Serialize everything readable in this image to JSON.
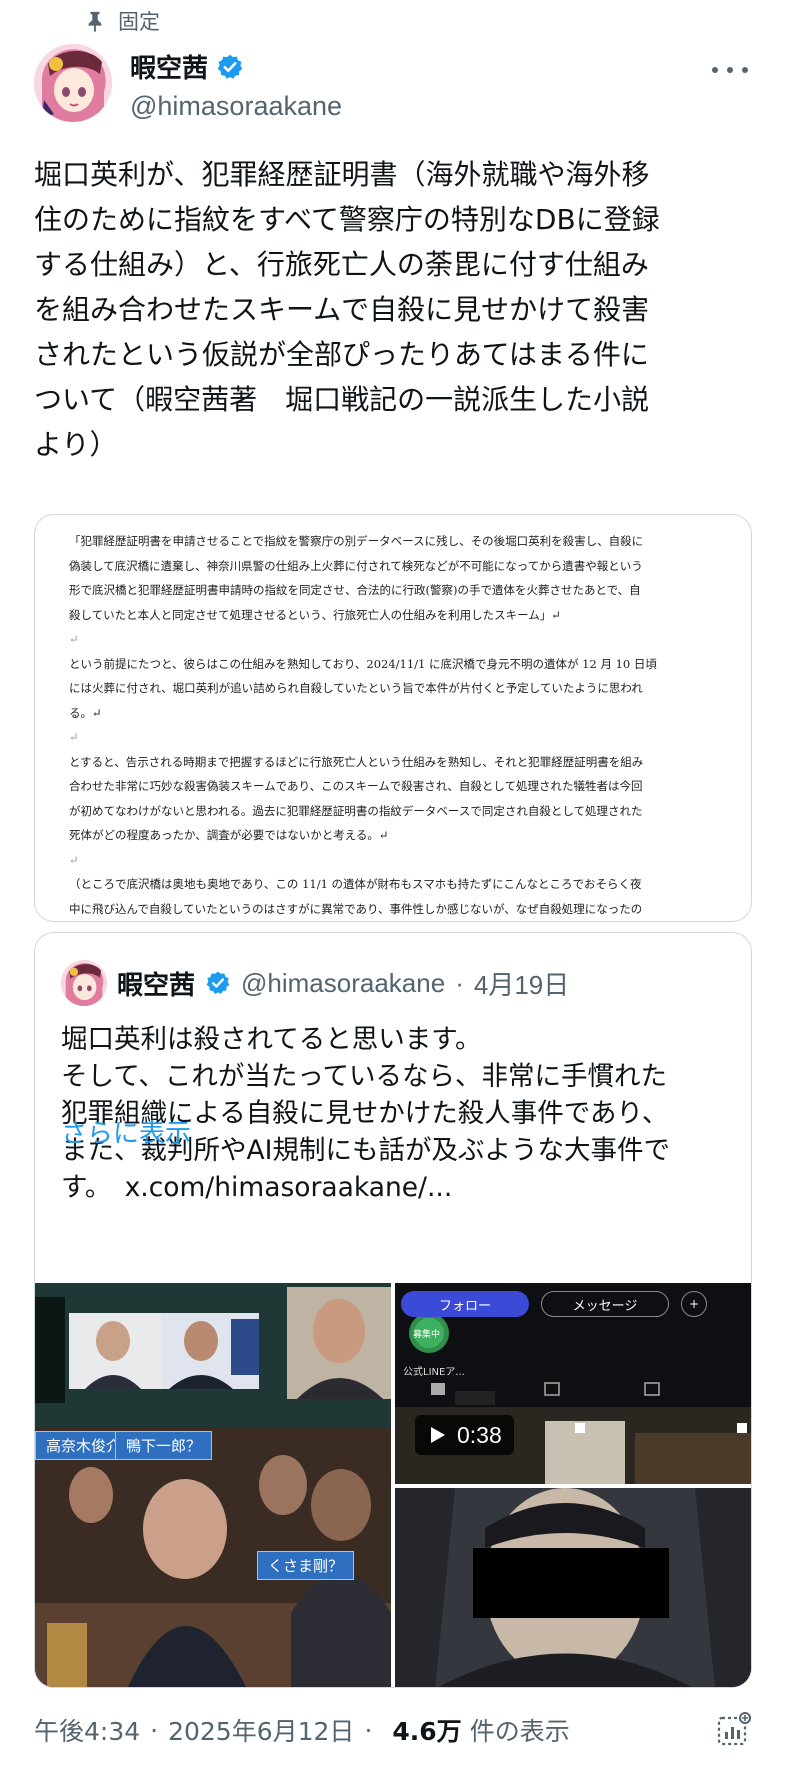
{
  "pinned": {
    "label": "固定"
  },
  "author": {
    "display_name": "暇空茜",
    "handle": "@himasoraakane"
  },
  "tweet": {
    "text": "堀口英利が、犯罪経歴証明書（海外就職や海外移\n住のために指紋をすべて警察庁の特別なDBに登録\nする仕組み）と、行旅死亡人の荼毘に付す仕組み\nを組み合わせたスキームで自殺に見せかけて殺害\nされたという仮説が全部ぴったりあてはまる件に\nついて（暇空茜著　堀口戦記の一説派生した小説\nより）"
  },
  "document": {
    "paragraphs": [
      "「犯罪経歴証明書を申請させることで指紋を警察庁の別データベースに残し、その後堀口英利を殺害し、自殺に\n偽装して底沢橋に遺棄し、神奈川県警の仕組み上火葬に付されて検死などが不可能になってから遺書や報という\n形で底沢橋と犯罪経歴証明書申請時の指紋を同定させ、合法的に行政(警察)の手で遺体を火葬させたあとで、自\n殺していたと本人と同定させて処理させるという、行旅死亡人の仕組みを利用したスキーム」↵",
      "↵",
      "という前提にたつと、彼らはこの仕組みを熟知しており、2024/11/1 に底沢橋で身元不明の遺体が 12 月 10 日頃\nには火葬に付され、堀口英利が追い詰められ自殺していたという旨で本件が片付くと予定していたように思われ\nる。↵",
      "↵",
      "とすると、告示される時期まで把握するほどに行旅死亡人という仕組みを熟知し、それと犯罪経歴証明書を組み\n合わせた非常に巧妙な殺害偽装スキームであり、このスキームで殺害され、自殺として処理された犠牲者は今回\nが初めてなわけがないと思われる。過去に犯罪経歴証明書の指紋データベースで同定され自殺として処理された\n死体がどの程度あったか、調査が必要ではないかと考える。↵",
      "↵",
      "（ところで底沢橋は奥地も奥地であり、この 11/1 の遺体が財布もスマホも持たずにこんなところでおそらく夜\n中に飛び込んで自殺していたというのはさすがに異常であり、事件性しか感じないが、なぜ自殺処理になったの\nか、神奈川県警察の怠慢すら疑われる）↵"
    ]
  },
  "quote": {
    "display_name": "暇空茜",
    "handle": "@himasoraakane",
    "date": "4月19日",
    "text": "堀口英利は殺されてると思います。\nそして、これが当たっているなら、非常に手慣れた\n犯罪組織による自殺に見せかけた殺人事件であり、\nまた、裁判所やAI規制にも話が及ぶような大事件で\nす。　x.com/himasoraakane/...",
    "show_more": "さらに表示",
    "media": {
      "photo1_tags": [
        "高奈木俊介？",
        "鴨下一郎？",
        "くさま剛？"
      ],
      "video_buttons": [
        "フォロー",
        "メッセージ"
      ],
      "video_badge_text": "募集中",
      "video_caption": "公式LINEア...",
      "video_duration": "0:38"
    }
  },
  "footer": {
    "time": "午後4:34",
    "date": "2025年6月12日",
    "views_count": "4.6万",
    "views_label": "件の表示"
  },
  "colors": {
    "link": "#1d9bf0",
    "verified": "#1d9bf0",
    "muted": "#536471"
  },
  "icons": [
    "pin-icon",
    "verified-icon",
    "more-icon",
    "play-icon",
    "analytics-icon"
  ]
}
